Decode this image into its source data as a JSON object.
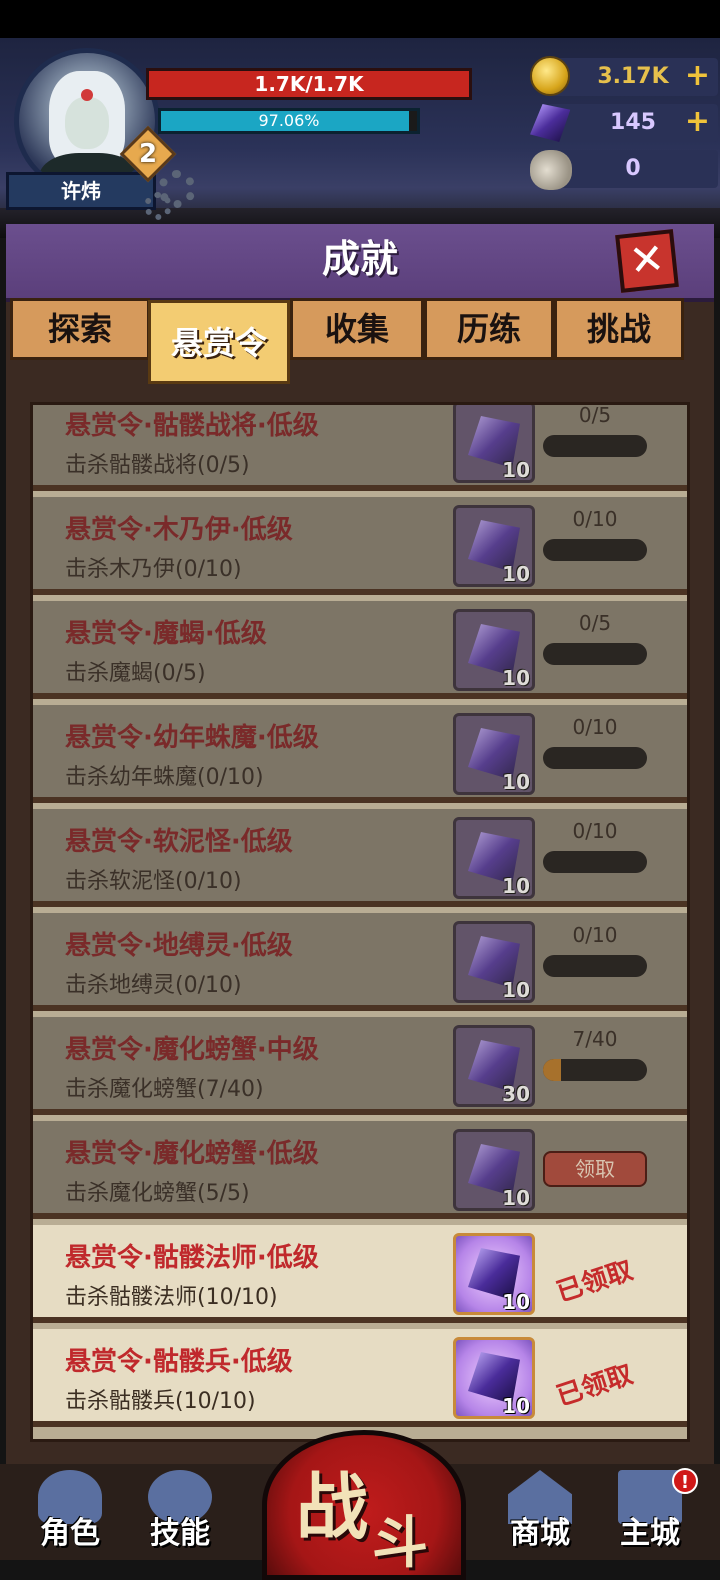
{
  "player": {
    "name": "许炜",
    "level": "2",
    "hp_text": "1.7K/1.7K",
    "xp_text": "97.06%",
    "xp_fraction": 0.9706
  },
  "resources": {
    "gold": "3.17K",
    "crystal": "145",
    "ram_horn": "0",
    "plus": "+"
  },
  "panel": {
    "title": "成就",
    "close": "✕"
  },
  "tabs": [
    {
      "label": "探索"
    },
    {
      "label": "悬赏令",
      "active": true
    },
    {
      "label": "收集"
    },
    {
      "label": "历练"
    },
    {
      "label": "挑战"
    }
  ],
  "quests": [
    {
      "title": "悬赏令·骷髅战将·低级",
      "desc": "击杀骷髅战将(0/5)",
      "reward": "10",
      "progress": "0/5",
      "fraction": 0,
      "status": "pending"
    },
    {
      "title": "悬赏令·木乃伊·低级",
      "desc": "击杀木乃伊(0/10)",
      "reward": "10",
      "progress": "0/10",
      "fraction": 0,
      "status": "pending"
    },
    {
      "title": "悬赏令·魔蝎·低级",
      "desc": "击杀魔蝎(0/5)",
      "reward": "10",
      "progress": "0/5",
      "fraction": 0,
      "status": "pending"
    },
    {
      "title": "悬赏令·幼年蛛魔·低级",
      "desc": "击杀幼年蛛魔(0/10)",
      "reward": "10",
      "progress": "0/10",
      "fraction": 0,
      "status": "pending"
    },
    {
      "title": "悬赏令·软泥怪·低级",
      "desc": "击杀软泥怪(0/10)",
      "reward": "10",
      "progress": "0/10",
      "fraction": 0,
      "status": "pending"
    },
    {
      "title": "悬赏令·地缚灵·低级",
      "desc": "击杀地缚灵(0/10)",
      "reward": "10",
      "progress": "0/10",
      "fraction": 0,
      "status": "pending"
    },
    {
      "title": "悬赏令·魔化螃蟹·中级",
      "desc": "击杀魔化螃蟹(7/40)",
      "reward": "30",
      "progress": "7/40",
      "fraction": 0.175,
      "status": "pending"
    },
    {
      "title": "悬赏令·魔化螃蟹·低级",
      "desc": "击杀魔化螃蟹(5/5)",
      "reward": "10",
      "button": "领取",
      "status": "claimable"
    },
    {
      "title": "悬赏令·骷髅法师·低级",
      "desc": "击杀骷髅法师(10/10)",
      "reward": "10",
      "stamp": "已领取",
      "status": "done"
    },
    {
      "title": "悬赏令·骷髅兵·低级",
      "desc": "击杀骷髅兵(10/10)",
      "reward": "10",
      "stamp": "已领取",
      "status": "done"
    }
  ],
  "nav": {
    "role": "角色",
    "skill": "技能",
    "fight_1": "战",
    "fight_2": "斗",
    "shop": "商城",
    "city": "主城",
    "alert": "!"
  }
}
